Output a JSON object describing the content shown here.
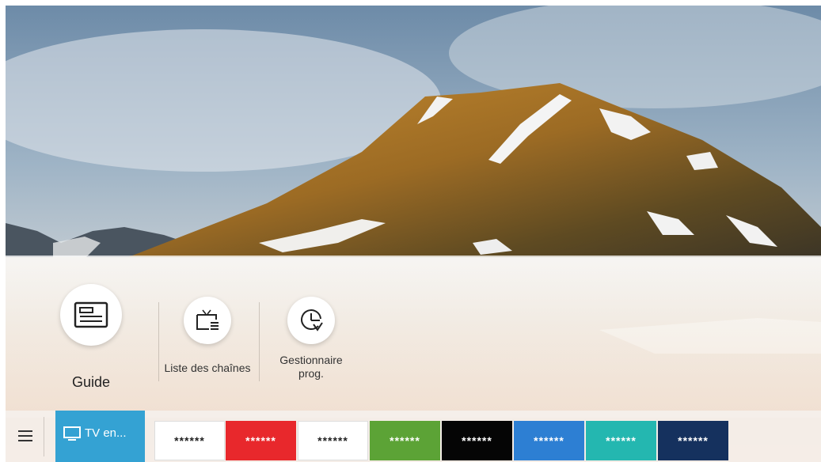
{
  "menu": {
    "items": [
      {
        "label": "Guide",
        "icon": "guide-icon"
      },
      {
        "label": "Liste des chaînes",
        "icon": "channel-list-icon"
      },
      {
        "label": "Gestionnaire\nprog.",
        "icon": "schedule-manager-icon"
      }
    ]
  },
  "taskbar": {
    "menu_icon": "hamburger-icon",
    "tv_tile": {
      "label": "TV en...",
      "icon": "tv-icon",
      "color": "#34a2d3"
    },
    "apps": [
      {
        "label": "******",
        "bg": "#ffffff",
        "fg": "#222222"
      },
      {
        "label": "******",
        "bg": "#e8282c",
        "fg": "#ffffff"
      },
      {
        "label": "******",
        "bg": "#ffffff",
        "fg": "#222222"
      },
      {
        "label": "******",
        "bg": "#5ca336",
        "fg": "#ffffff"
      },
      {
        "label": "******",
        "bg": "#050505",
        "fg": "#ffffff"
      },
      {
        "label": "******",
        "bg": "#2d7fd3",
        "fg": "#ffffff"
      },
      {
        "label": "******",
        "bg": "#24b7b0",
        "fg": "#ffffff"
      },
      {
        "label": "******",
        "bg": "#15315e",
        "fg": "#ffffff"
      }
    ]
  }
}
